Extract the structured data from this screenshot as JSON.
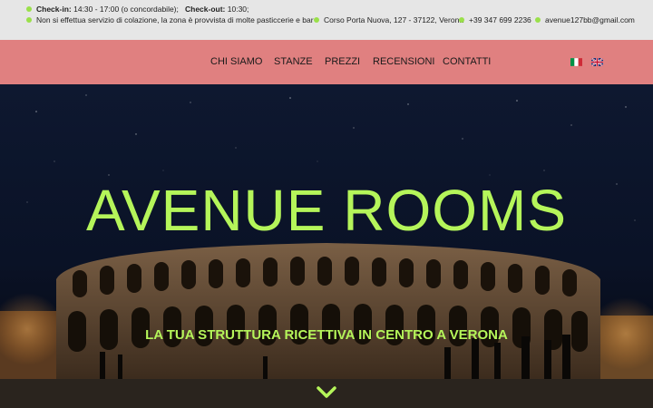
{
  "topbar": {
    "checkin_label": "Check-in:",
    "checkin_value": "14:30 - 17:00 (o concordabile);",
    "checkout_label": "Check-out:",
    "checkout_value": "10:30;",
    "notice": "Non si effettua servizio di colazione, la zona è provvista di molte pasticcerie e bar",
    "address": "Corso Porta Nuova, 127 - 37122, Verona",
    "phone": "+39 347 699 2236",
    "email": "avenue127bb@gmail.com"
  },
  "nav": {
    "items": [
      "CHI SIAMO",
      "STANZE",
      "PREZZI",
      "RECENSIONI",
      "CONTATTI"
    ]
  },
  "hero": {
    "title": "AVENUE ROOMS",
    "subtitle": "LA TUA STRUTTURA RICETTIVA IN CENTRO A VERONA"
  },
  "colors": {
    "topbar_bg": "#e6e6e6",
    "navbar_bg": "#e08080",
    "accent_green": "#b5f55a"
  },
  "icons": {
    "languages": [
      "italian-flag-icon",
      "uk-flag-icon"
    ],
    "scroll": "chevron-down-icon"
  }
}
